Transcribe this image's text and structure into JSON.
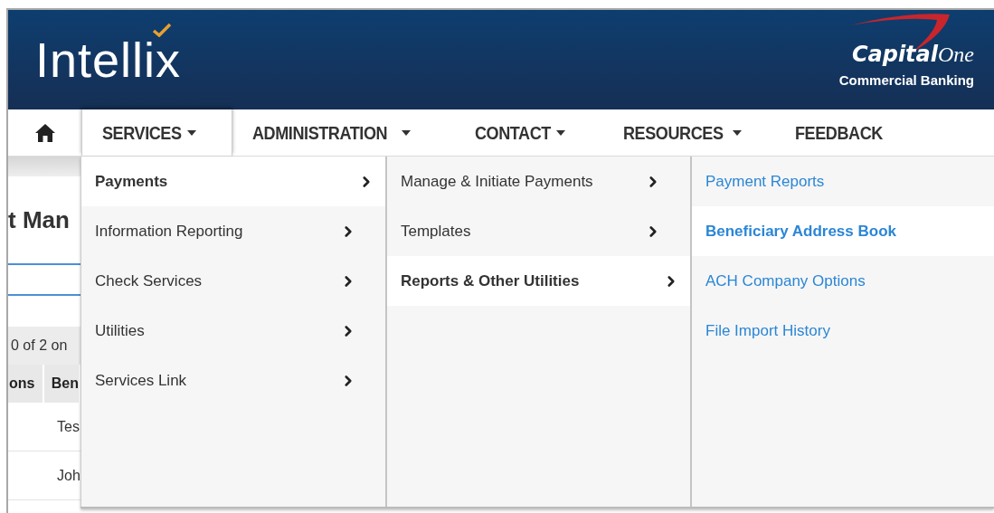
{
  "header": {
    "logo": "Intellix",
    "brand": {
      "name_bold": "Capital",
      "name_script": "One",
      "tagline": "Commercial Banking"
    }
  },
  "nav": [
    {
      "kind": "home",
      "selected": false
    },
    {
      "kind": "menu",
      "label": "SERVICES",
      "dropdown": true,
      "selected": true
    },
    {
      "kind": "menu",
      "label": "ADMINISTRATION",
      "dropdown": true,
      "selected": false
    },
    {
      "kind": "menu",
      "label": "CONTACT",
      "dropdown": true,
      "selected": false
    },
    {
      "kind": "menu",
      "label": "RESOURCES",
      "dropdown": true,
      "selected": false
    },
    {
      "kind": "menu",
      "label": "FEEDBACK",
      "dropdown": false,
      "selected": false
    }
  ],
  "page": {
    "title": "t Man",
    "pager": "0 of 2 on",
    "columns": [
      "ons",
      "Ben"
    ],
    "rows": [
      "Tes",
      "Joh"
    ]
  },
  "menu": {
    "columns": [
      {
        "kind": "category",
        "items": [
          {
            "label": "Payments",
            "submenu": true,
            "selected": true
          },
          {
            "label": "Information Reporting",
            "submenu": true,
            "selected": false
          },
          {
            "label": "Check Services",
            "submenu": true,
            "selected": false
          },
          {
            "label": "Utilities",
            "submenu": true,
            "selected": false
          },
          {
            "label": "Services Link",
            "submenu": true,
            "selected": false
          }
        ]
      },
      {
        "kind": "category",
        "items": [
          {
            "label": "Manage & Initiate Payments",
            "submenu": true,
            "selected": false
          },
          {
            "label": "Templates",
            "submenu": true,
            "selected": false
          },
          {
            "label": "Reports & Other Utilities",
            "submenu": true,
            "selected": true
          }
        ]
      },
      {
        "kind": "link",
        "items": [
          {
            "label": "Payment Reports",
            "submenu": false,
            "selected": false
          },
          {
            "label": "Beneficiary Address Book",
            "submenu": false,
            "selected": true
          },
          {
            "label": "ACH Company Options",
            "submenu": false,
            "selected": false
          },
          {
            "label": "File Import History",
            "submenu": false,
            "selected": false
          }
        ]
      }
    ]
  }
}
